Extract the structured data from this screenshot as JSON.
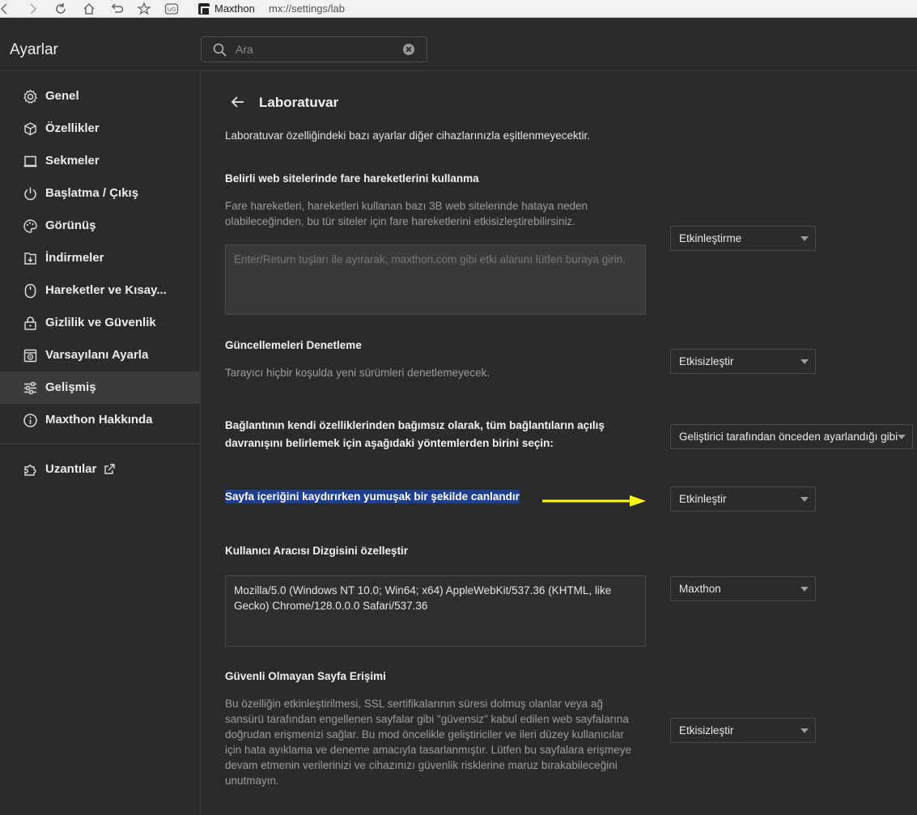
{
  "browser": {
    "brand": "Maxthon",
    "url": "mx://settings/lab"
  },
  "header": {
    "title": "Ayarlar",
    "search_placeholder": "Ara"
  },
  "sidebar": {
    "items": [
      {
        "label": "Genel",
        "icon": "gear-icon"
      },
      {
        "label": "Özellikler",
        "icon": "cube-icon"
      },
      {
        "label": "Sekmeler",
        "icon": "tab-icon"
      },
      {
        "label": "Başlatma / Çıkış",
        "icon": "power-icon"
      },
      {
        "label": "Görünüş",
        "icon": "palette-icon"
      },
      {
        "label": "İndirmeler",
        "icon": "download-icon"
      },
      {
        "label": "Hareketler ve Kısay...",
        "icon": "mouse-icon"
      },
      {
        "label": "Gizlilik ve Güvenlik",
        "icon": "lock-icon"
      },
      {
        "label": "Varsayılanı Ayarla",
        "icon": "browser-icon"
      },
      {
        "label": "Gelişmiş",
        "icon": "sliders-icon",
        "active": true
      },
      {
        "label": "Maxthon Hakkında",
        "icon": "info-icon"
      }
    ],
    "extensions_label": "Uzantılar"
  },
  "main": {
    "title": "Laboratuvar",
    "intro": "Laboratuvar özelliğindeki bazı ayarlar diğer cihazlarınızla eşitlenmeyecektir.",
    "sections": {
      "mouse": {
        "title": "Belirli web sitelerinde fare hareketlerini kullanma",
        "desc_line1": "Fare hareketleri, hareketleri kullanan bazı 3B web sitelerinde hataya neden",
        "desc_line2": "olabileceğinden, bu tür siteler için fare hareketlerini etkisizleştirebilirsiniz.",
        "placeholder": "Enter/Return tuşları ile ayırarak, maxthon.com gibi etki alanını lütfen buraya girin.",
        "select": "Etkinleştirme"
      },
      "updates": {
        "title": "Güncellemeleri Denetleme",
        "desc": "Tarayıcı hiçbir koşulda yeni sürümleri denetlemeyecek.",
        "select": "Etkisizleştir"
      },
      "links": {
        "title_line1": "Bağlantının kendi özelliklerinden bağımsız olarak, tüm bağlantıların açılış",
        "title_line2": "davranışını belirlemek için aşağıdaki yöntemlerden birini seçin:",
        "select": "Geliştirici tarafından önceden ayarlandığı gibi"
      },
      "smooth": {
        "title": "Sayfa içeriğini kaydırırken yumuşak bir şekilde canlandır",
        "select": "Etkinleştir"
      },
      "useragent": {
        "title": "Kullanıcı Aracısı Dizgisini özelleştir",
        "value": "Mozilla/5.0 (Windows NT 10.0; Win64; x64) AppleWebKit/537.36 (KHTML, like Gecko) Chrome/128.0.0.0 Safari/537.36",
        "select": "Maxthon"
      },
      "insecure": {
        "title": "Güvenli Olmayan Sayfa Erişimi",
        "desc_line1": "Bu özelliğin etkinleştirilmesi, SSL sertifikalarının süresi dolmuş olanlar veya ağ",
        "desc_line2": "sansürü tarafından engellenen sayfalar gibi \"güvensiz\" kabul edilen web sayfalarına",
        "desc_line3": "doğrudan erişmenizi sağlar. Bu mod öncelikle geliştiriciler ve ileri düzey kullanıcılar",
        "desc_line4": "için hata ayıklama ve deneme amacıyla tasarlanmıştır. Lütfen bu sayfalara erişmeye",
        "desc_line5": "devam etmenin verilerinizi ve cihazınızı güvenlik risklerine maruz bırakabileceğini",
        "desc_line6": "unutmayın.",
        "select": "Etkisizleştir"
      }
    }
  },
  "colors": {
    "highlight": "#1c3f8f",
    "annotation_arrow": "#ffff00"
  }
}
